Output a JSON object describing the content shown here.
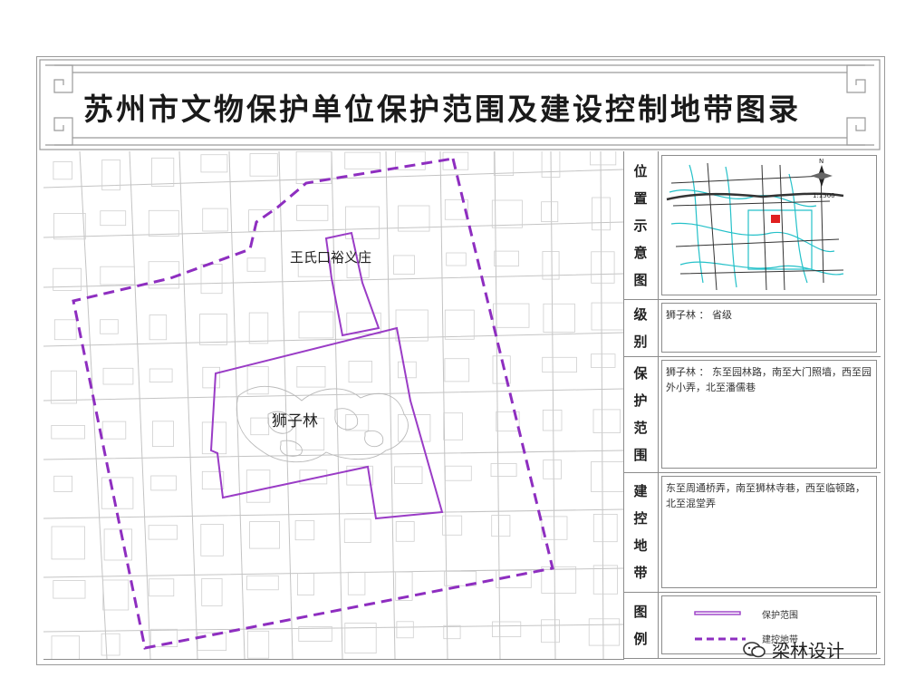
{
  "title": "苏州市文物保护单位保护范围及建设控制地带图录",
  "map": {
    "labels": {
      "site_upper": "王氏口裕义庄",
      "site_main": "狮子林"
    },
    "colors": {
      "protection_line": "#9a3cc6",
      "control_line": "#8e2ec0",
      "streets": "#bdbdbd",
      "minimap_water": "#25c1c9"
    }
  },
  "side": {
    "location": {
      "heading": [
        "位",
        "置",
        "示",
        "意",
        "图"
      ],
      "scale": "1:1500",
      "north": "N"
    },
    "level": {
      "heading": [
        "级",
        "别"
      ],
      "text": "狮子林 ： 省级"
    },
    "protection": {
      "heading": [
        "保",
        "护",
        "范",
        "围"
      ],
      "text": "狮子林 ： 东至园林路，南至大门照墙，西至园外小弄，北至潘儒巷"
    },
    "control": {
      "heading": [
        "建",
        "控",
        "地",
        "带"
      ],
      "text": "东至周通桥弄，南至狮林寺巷，西至临顿路，北至混堂弄"
    },
    "legend": {
      "heading": [
        "图",
        "例"
      ],
      "items": [
        {
          "label": "保护范围",
          "style": "solid"
        },
        {
          "label": "建控地带",
          "style": "dashed"
        }
      ]
    }
  },
  "watermark": "梁林设计"
}
